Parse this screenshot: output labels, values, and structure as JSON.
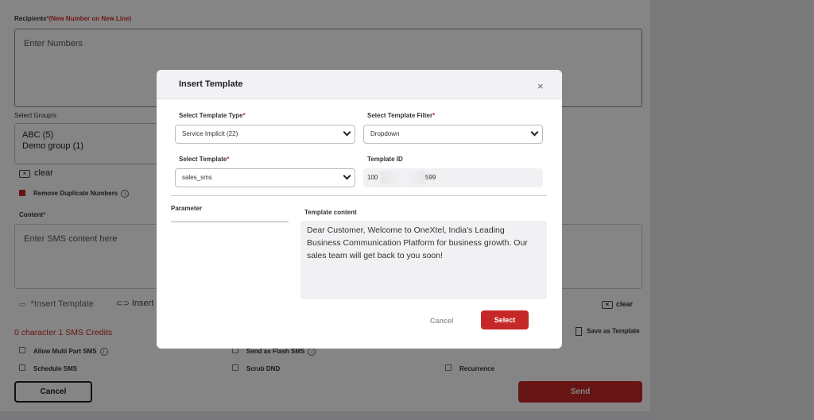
{
  "form": {
    "recipients_label": "Recipients",
    "recipients_req": "*",
    "recipients_hint": "(New Number on New Line)",
    "recipients_placeholder": "Enter Numbers",
    "groups_label": "Select Group/s",
    "groups": [
      "ABC (5)",
      "Demo group (1)"
    ],
    "clear_label": "clear",
    "remove_dup_label": "Remove Duplicate Numbers",
    "content_label": "Content",
    "content_req": "*",
    "content_placeholder": "Enter SMS content here",
    "insert_template_label": "*Insert Template",
    "insert_link_label": "Insert U",
    "clear2_label": "clear",
    "credits_text": "0 character 1 SMS Credits",
    "save_template_label": "Save as Template",
    "allow_multi_label": "Allow Multi Part SMS",
    "flash_label": "Send as Flash SMS",
    "schedule_label": "Schedule SMS",
    "scrub_label": "Scrub DND",
    "recurrence_label": "Recurrence",
    "cancel_label": "Cancel",
    "send_label": "Send"
  },
  "modal": {
    "title": "Insert Template",
    "close_glyph": "×",
    "template_type_label": "Select Template Type",
    "template_type_value": "Service Implicit (22)",
    "template_filter_label": "Select Template Filter",
    "template_filter_value": "Dropdown",
    "template_label": "Select Template",
    "template_value": "sales_sms",
    "template_id_label": "Template ID",
    "template_id_start": "100",
    "template_id_end": "599",
    "required_mark": "*",
    "parameter_label": "Parameter",
    "content_label": "Template content",
    "content_text": "Dear Customer, Welcome to OneXtel, India's Leading Business Communication Platform for business growth. Our sales team will get back to you soon!",
    "cancel_label": "Cancel",
    "select_label": "Select"
  },
  "colors": {
    "accent": "#c62828",
    "overlay": "rgba(0,0,0,0.48)"
  }
}
